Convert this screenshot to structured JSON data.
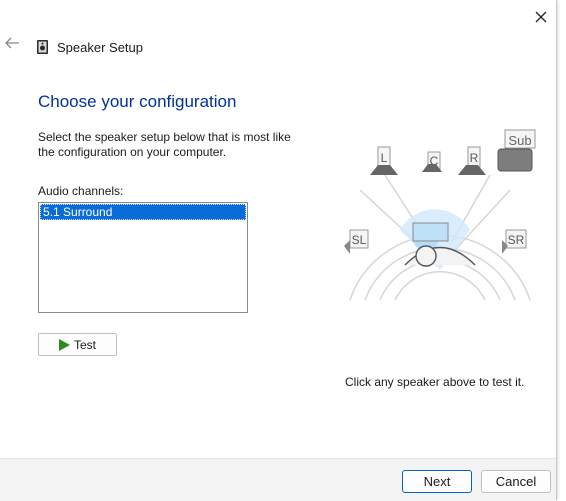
{
  "window": {
    "title": "Speaker Setup"
  },
  "page": {
    "heading": "Choose your configuration",
    "instructions": "Select the speaker setup below that is most like the configuration on your computer.",
    "channels_label": "Audio channels:"
  },
  "channels": {
    "options": [
      "5.1 Surround"
    ],
    "selected": "5.1 Surround"
  },
  "buttons": {
    "test": "Test",
    "next": "Next",
    "cancel": "Cancel"
  },
  "speakers": {
    "left": "L",
    "center": "C",
    "right": "R",
    "sub": "Sub",
    "surround_left": "SL",
    "surround_right": "SR"
  },
  "hint": "Click any speaker above to test it.",
  "colors": {
    "heading": "#003399",
    "selection": "#0a6cd9",
    "play": "#2e8b1f",
    "primary_border": "#0067c0"
  }
}
